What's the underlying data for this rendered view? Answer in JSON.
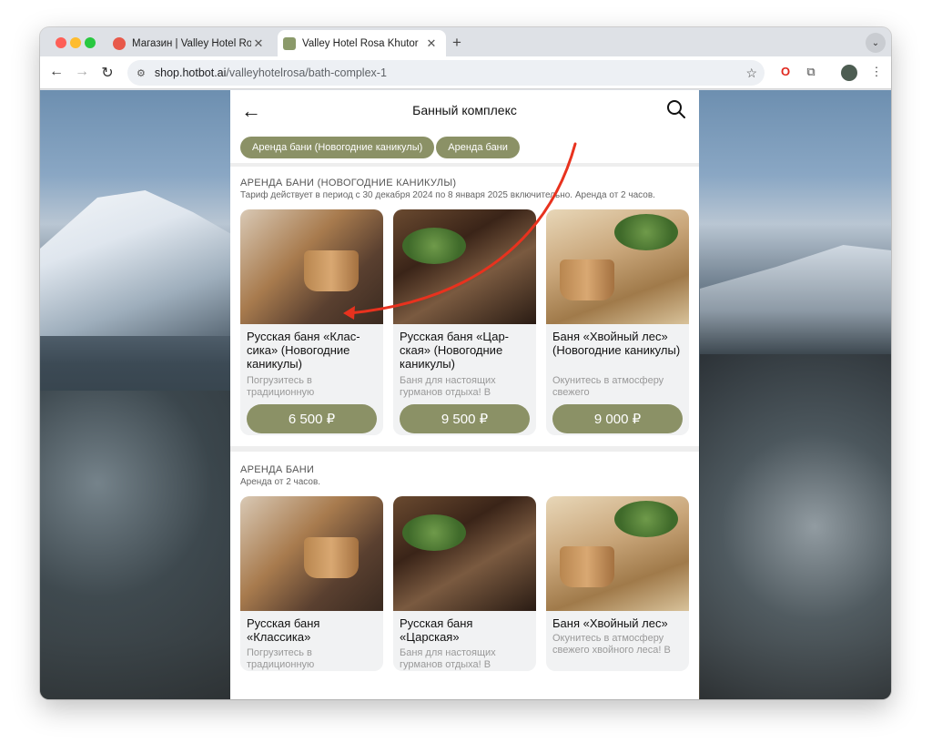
{
  "browser": {
    "tabs": [
      {
        "title": "Магазин | Valley Hotel Rosa K",
        "active": false
      },
      {
        "title": "Valley Hotel Rosa Khutor",
        "active": true
      }
    ],
    "url_host": "shop.hotbot.ai",
    "url_path": "/valleyhotelrosa/bath-complex-1"
  },
  "page": {
    "title": "Банный комплекс",
    "chips": [
      "Аренда бани (Новогодние каникулы)",
      "Аренда бани"
    ]
  },
  "sections": [
    {
      "title": "АРЕНДА БАНИ (НОВОГОДНИЕ КАНИКУЛЫ)",
      "desc": "Тариф действует в период с 30 декабря 2024 по 8 января 2025 включительно. Аренда от 2 часов.",
      "cards": [
        {
          "name": "Русская баня «Клас-сика» (Новогодние каникулы)",
          "desc": "Погрузитесь в традиционную",
          "price": "6 500 ₽"
        },
        {
          "name": "Русская баня «Цар-ская» (Новогодние каникулы)",
          "desc": "Баня для настоящих гурманов отдыха! В",
          "price": "9 500 ₽"
        },
        {
          "name": "Баня «Хвойный лес» (Новогодние каникулы)",
          "desc": "Окунитесь в атмосферу свежего",
          "price": "9 000 ₽"
        }
      ]
    },
    {
      "title": "АРЕНДА БАНИ",
      "desc": "Аренда от 2 часов.",
      "cards": [
        {
          "name": "Русская баня «Классика»",
          "desc": "Погрузитесь в традиционную"
        },
        {
          "name": "Русская баня «Царская»",
          "desc": "Баня для настоящих гурманов отдыха! В"
        },
        {
          "name": "Баня «Хвойный лес»",
          "desc": "Окунитесь в атмосферу свежего хвойного леса! В"
        }
      ]
    }
  ],
  "colors": {
    "accent": "#8b9166",
    "annotation_arrow": "#e8321e"
  }
}
